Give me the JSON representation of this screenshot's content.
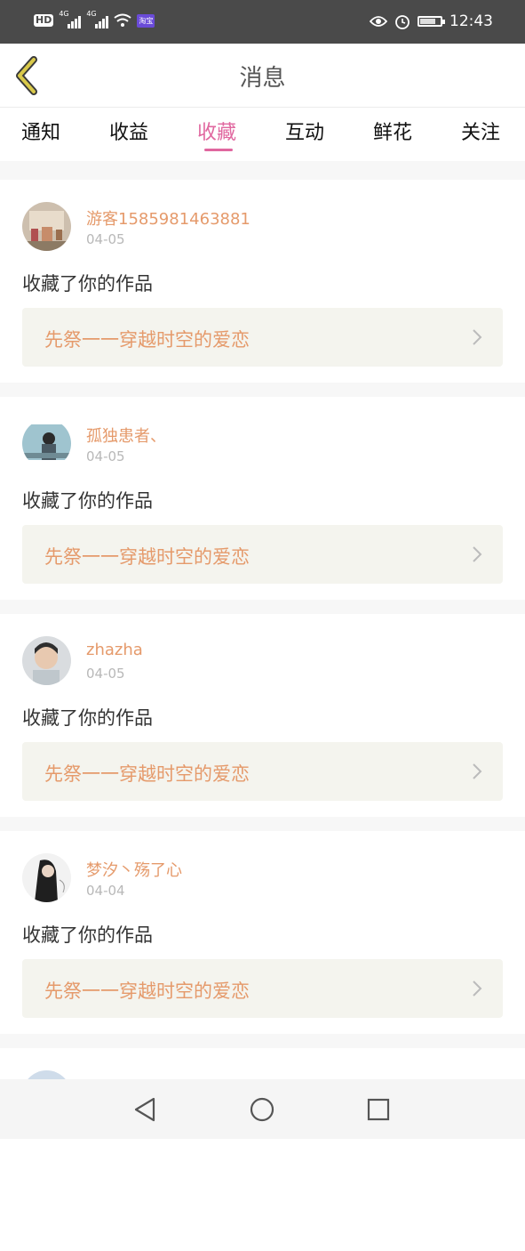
{
  "status_bar": {
    "hd_label": "HD",
    "signal_1_label": "4G",
    "signal_2_label": "4G",
    "taobao_badge": "淘宝",
    "time": "12:43",
    "icons": [
      "eye-icon",
      "alarm-icon",
      "battery-icon",
      "wifi-icon",
      "signal-icon"
    ]
  },
  "header": {
    "title": "消息",
    "back_icon": "chevron-left-icon",
    "accent_color": "#d9c94a"
  },
  "tabs": [
    {
      "label": "通知",
      "active": false
    },
    {
      "label": "收益",
      "active": false
    },
    {
      "label": "收藏",
      "active": true
    },
    {
      "label": "互动",
      "active": false
    },
    {
      "label": "鲜花",
      "active": false
    },
    {
      "label": "关注",
      "active": false
    }
  ],
  "colors": {
    "active_tab": "#e0679f",
    "username": "#e59a6b",
    "work_title": "#e59a6b",
    "work_background": "#f4f4ee"
  },
  "messages": [
    {
      "username": "游客1585981463881",
      "date": "04-05",
      "action": "收藏了你的作品",
      "work_title": "先祭一一穿越时空的爱恋"
    },
    {
      "username": "孤独患者、",
      "date": "04-05",
      "action": "收藏了你的作品",
      "work_title": "先祭一一穿越时空的爱恋"
    },
    {
      "username": "zhazha",
      "date": "04-05",
      "action": "收藏了你的作品",
      "work_title": "先祭一一穿越时空的爱恋"
    },
    {
      "username": "梦汐丶殇了心",
      "date": "04-04",
      "action": "收藏了你的作品",
      "work_title": "先祭一一穿越时空的爱恋"
    }
  ],
  "nav_bar": {
    "icons": [
      "back-triangle-icon",
      "home-circle-icon",
      "recents-square-icon"
    ]
  }
}
